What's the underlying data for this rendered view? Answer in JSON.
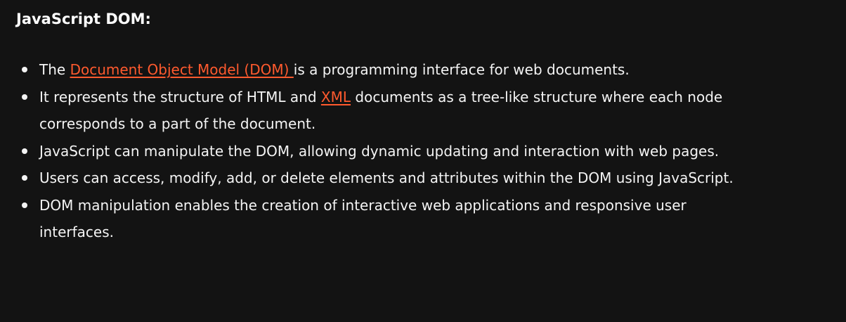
{
  "heading": "JavaScript DOM:",
  "link_color": "#ff5a2e",
  "background_color": "#131313",
  "bullets": [
    {
      "pre": "The ",
      "link": "Document Object Model (DOM) ",
      "post": "is a programming interface for web documents."
    },
    {
      "pre": "It represents the structure of HTML and ",
      "link": "XML",
      "post": " documents as a tree-like structure where each node corresponds to a part of the document."
    },
    {
      "text": "JavaScript can manipulate the DOM, allowing dynamic updating and interaction with web pages."
    },
    {
      "text": "Users can access, modify, add, or delete elements and attributes within the DOM using JavaScript."
    },
    {
      "text": "DOM manipulation enables the creation of interactive web applications and responsive user interfaces."
    }
  ]
}
